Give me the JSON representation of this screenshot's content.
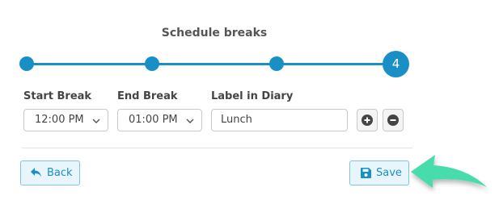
{
  "title": "Schedule breaks",
  "stepper": {
    "current_step": "4"
  },
  "fields": {
    "start": {
      "label": "Start Break",
      "value": "12:00 PM"
    },
    "end": {
      "label": "End Break",
      "value": "01:00 PM"
    },
    "diary": {
      "label": "Label in Diary",
      "value": "Lunch"
    }
  },
  "buttons": {
    "back": "Back",
    "save": "Save"
  },
  "colors": {
    "accent": "#1a8fc6",
    "arrow": "#46dcab"
  }
}
